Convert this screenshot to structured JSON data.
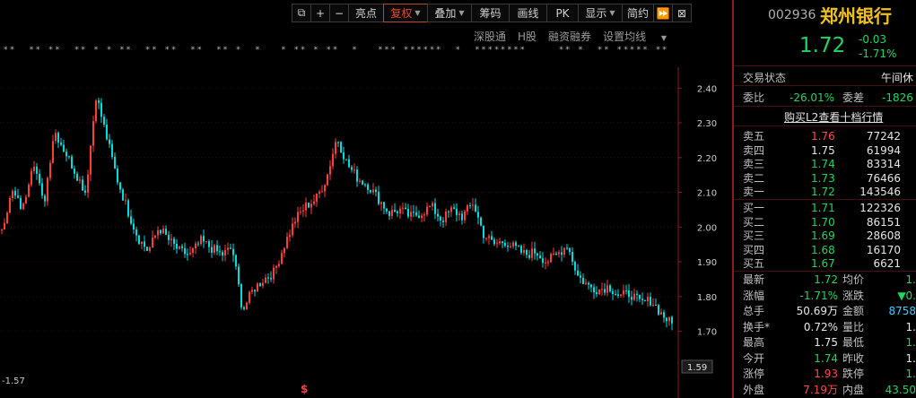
{
  "toolbar": {
    "icons": [
      "copy-icon",
      "plus-icon",
      "minus-icon"
    ],
    "buttons": [
      "亮点",
      "复权",
      "叠加",
      "筹码",
      "画线",
      "PK",
      "显示",
      "简约"
    ],
    "active": "复权",
    "dropdowns": [
      "复权",
      "叠加",
      "显示"
    ]
  },
  "sublinks": [
    "深股通",
    "H股",
    "融资融券",
    "设置均线"
  ],
  "chart_data": {
    "type": "candlestick",
    "ylim": [
      1.57,
      2.46
    ],
    "yticks": [
      2.4,
      2.3,
      2.2,
      2.1,
      2.0,
      1.9,
      1.8,
      1.7
    ],
    "y_current_label": "1.59",
    "bottom_left_label": "-1.57",
    "marker_symbol": "$",
    "up_color": "#ff3c3c",
    "down_color": "#00dcdc",
    "close_path": [
      2.0,
      2.1,
      2.05,
      2.2,
      2.06,
      2.28,
      2.22,
      2.16,
      2.1,
      2.38,
      2.26,
      2.14,
      2.05,
      1.97,
      1.93,
      2.0,
      1.96,
      1.93,
      1.92,
      1.96,
      1.94,
      1.92,
      1.94,
      1.76,
      1.82,
      1.85,
      1.87,
      1.95,
      2.02,
      2.06,
      2.08,
      2.14,
      2.26,
      2.18,
      2.14,
      2.12,
      2.08,
      2.04,
      2.05,
      2.03,
      2.04,
      2.06,
      2.02,
      2.05,
      2.03,
      2.07,
      1.98,
      1.95,
      1.96,
      1.94,
      1.92,
      1.93,
      1.9,
      1.92,
      1.95,
      1.86,
      1.83,
      1.82,
      1.83,
      1.8,
      1.81,
      1.78,
      1.79,
      1.75,
      1.72
    ]
  },
  "stock": {
    "code": "002936",
    "name": "郑州银行",
    "price": "1.72",
    "change": "-0.03",
    "change_pct": "-1.71%"
  },
  "status": {
    "label": "交易状态",
    "value": "午间休",
    "wb_label": "委比",
    "wb_value": "-26.01%",
    "wc_label": "委差",
    "wc_value": "-1826"
  },
  "l2_link": "购买L2查看十档行情",
  "asks": [
    {
      "label": "卖五",
      "price": "1.76",
      "vol": "77242",
      "color": "red"
    },
    {
      "label": "卖四",
      "price": "1.75",
      "vol": "61994",
      "color": "white"
    },
    {
      "label": "卖三",
      "price": "1.74",
      "vol": "83314",
      "color": "green"
    },
    {
      "label": "卖二",
      "price": "1.73",
      "vol": "76466",
      "color": "green"
    },
    {
      "label": "卖一",
      "price": "1.72",
      "vol": "143546",
      "color": "green"
    }
  ],
  "bids": [
    {
      "label": "买一",
      "price": "1.71",
      "vol": "122326",
      "color": "green"
    },
    {
      "label": "买二",
      "price": "1.70",
      "vol": "86151",
      "color": "green"
    },
    {
      "label": "买三",
      "price": "1.69",
      "vol": "28608",
      "color": "green"
    },
    {
      "label": "买四",
      "price": "1.68",
      "vol": "16170",
      "color": "green"
    },
    {
      "label": "买五",
      "price": "1.67",
      "vol": "6621",
      "color": "green"
    }
  ],
  "stats": [
    {
      "l1": "最新",
      "v1": "1.72",
      "c1": "green",
      "l2": "均价",
      "v2": "1.",
      "c2": "green"
    },
    {
      "l1": "涨幅",
      "v1": "-1.71%",
      "c1": "green",
      "l2": "涨跌",
      "v2": "▼0.",
      "c2": "green"
    },
    {
      "l1": "总手",
      "v1": "50.69万",
      "c1": "white",
      "l2": "金额",
      "v2": "8758",
      "c2": "cyan"
    },
    {
      "l1": "换手*",
      "v1": "0.72%",
      "c1": "white",
      "l2": "量比",
      "v2": "1.",
      "c2": "white"
    },
    {
      "l1": "最高",
      "v1": "1.75",
      "c1": "white",
      "l2": "最低",
      "v2": "1.",
      "c2": "green"
    },
    {
      "l1": "今开",
      "v1": "1.74",
      "c1": "green",
      "l2": "昨收",
      "v2": "1.",
      "c2": "white"
    },
    {
      "l1": "涨停",
      "v1": "1.93",
      "c1": "red",
      "l2": "跌停",
      "v2": "1.",
      "c2": "green"
    },
    {
      "l1": "外盘",
      "v1": "7.19万",
      "c1": "red",
      "l2": "内盘",
      "v2": "43.50",
      "c2": "green"
    }
  ]
}
